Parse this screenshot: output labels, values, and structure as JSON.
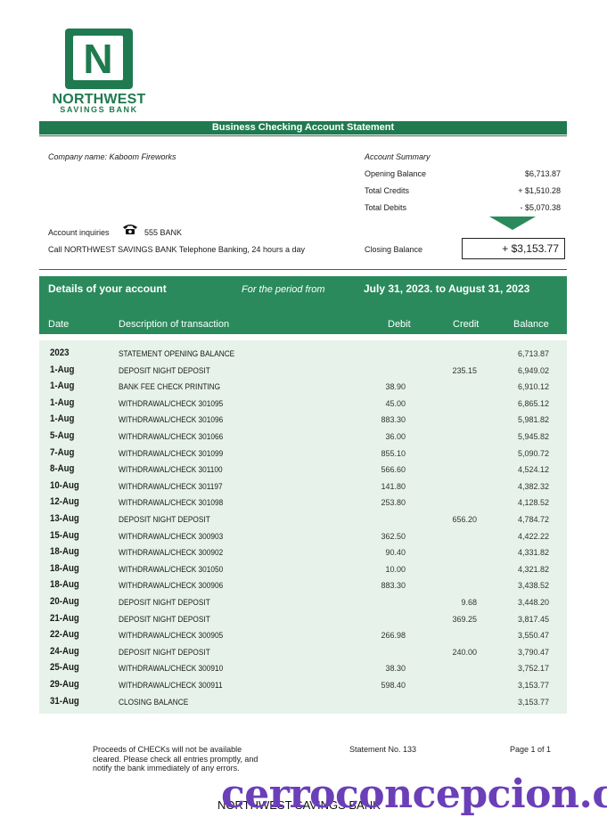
{
  "bank": {
    "logo_letter": "N",
    "name": "NORTHWEST",
    "sub": "SAVINGS BANK",
    "brand_color": "#1f7a4f"
  },
  "title": "Business Checking Account Statement",
  "company": "Company name: Kaboom Fireworks",
  "summary": {
    "heading": "Account Summary",
    "opening_label": "Opening Balance",
    "opening_value": "$6,713.87",
    "credits_label": "Total Credits",
    "credits_value": "+ $1,510.28",
    "debits_label": "Total Debits",
    "debits_value": "- $5,070.38",
    "closing_label": "Closing Balance",
    "closing_value": "+ $3,153.77"
  },
  "inquiries": {
    "label": "Account inquiries",
    "phone_icon": "telephone-icon",
    "phone": "555 BANK",
    "note": "Call NORTHWEST SAVINGS BANK Telephone Banking, 24 hours a day"
  },
  "details": {
    "heading": "Details of your account",
    "period_label": "For the period from",
    "period": "July 31, 2023. to August 31, 2023"
  },
  "columns": {
    "date": "Date",
    "desc": "Description of transaction",
    "debit": "Debit",
    "credit": "Credit",
    "balance": "Balance"
  },
  "transactions": [
    {
      "date": "2023",
      "desc": "STATEMENT OPENING BALANCE",
      "debit": "",
      "credit": "",
      "balance": "6,713.87"
    },
    {
      "date": "1-Aug",
      "desc": "DEPOSIT NIGHT DEPOSIT",
      "debit": "",
      "credit": "235.15",
      "balance": "6,949.02"
    },
    {
      "date": "1-Aug",
      "desc": "BANK FEE CHECK PRINTING",
      "debit": "38.90",
      "credit": "",
      "balance": "6,910.12"
    },
    {
      "date": "1-Aug",
      "desc": "WITHDRAWAL/CHECK 301095",
      "debit": "45.00",
      "credit": "",
      "balance": "6,865.12"
    },
    {
      "date": "1-Aug",
      "desc": "WITHDRAWAL/CHECK 301096",
      "debit": "883.30",
      "credit": "",
      "balance": "5,981.82"
    },
    {
      "date": "5-Aug",
      "desc": "WITHDRAWAL/CHECK 301066",
      "debit": "36.00",
      "credit": "",
      "balance": "5,945.82"
    },
    {
      "date": "7-Aug",
      "desc": "WITHDRAWAL/CHECK 301099",
      "debit": "855.10",
      "credit": "",
      "balance": "5,090.72"
    },
    {
      "date": "8-Aug",
      "desc": "WITHDRAWAL/CHECK 301100",
      "debit": "566.60",
      "credit": "",
      "balance": "4,524.12"
    },
    {
      "date": "10-Aug",
      "desc": "WITHDRAWAL/CHECK 301197",
      "debit": "141.80",
      "credit": "",
      "balance": "4,382.32"
    },
    {
      "date": "12-Aug",
      "desc": "WITHDRAWAL/CHECK 301098",
      "debit": "253.80",
      "credit": "",
      "balance": "4,128.52"
    },
    {
      "date": "13-Aug",
      "desc": "DEPOSIT NIGHT DEPOSIT",
      "debit": "",
      "credit": "656.20",
      "balance": "4,784.72"
    },
    {
      "date": "15-Aug",
      "desc": "WITHDRAWAL/CHECK 300903",
      "debit": "362.50",
      "credit": "",
      "balance": "4,422.22"
    },
    {
      "date": "18-Aug",
      "desc": "WITHDRAWAL/CHECK 300902",
      "debit": "90.40",
      "credit": "",
      "balance": "4,331.82"
    },
    {
      "date": "18-Aug",
      "desc": "WITHDRAWAL/CHECK 301050",
      "debit": "10.00",
      "credit": "",
      "balance": "4,321.82"
    },
    {
      "date": "18-Aug",
      "desc": "WITHDRAWAL/CHECK 300906",
      "debit": "883.30",
      "credit": "",
      "balance": "3,438.52"
    },
    {
      "date": "20-Aug",
      "desc": "DEPOSIT NIGHT DEPOSIT",
      "debit": "",
      "credit": "9.68",
      "balance": "3,448.20"
    },
    {
      "date": "21-Aug",
      "desc": "DEPOSIT NIGHT DEPOSIT",
      "debit": "",
      "credit": "369.25",
      "balance": "3,817.45"
    },
    {
      "date": "22-Aug",
      "desc": "WITHDRAWAL/CHECK 300905",
      "debit": "266.98",
      "credit": "",
      "balance": "3,550.47"
    },
    {
      "date": "24-Aug",
      "desc": "DEPOSIT NIGHT DEPOSIT",
      "debit": "",
      "credit": "240.00",
      "balance": "3,790.47"
    },
    {
      "date": "25-Aug",
      "desc": "WITHDRAWAL/CHECK 300910",
      "debit": "38.30",
      "credit": "",
      "balance": "3,752.17"
    },
    {
      "date": "29-Aug",
      "desc": "WITHDRAWAL/CHECK 300911",
      "debit": "598.40",
      "credit": "",
      "balance": "3,153.77"
    },
    {
      "date": "31-Aug",
      "desc": "CLOSING BALANCE",
      "debit": "",
      "credit": "",
      "balance": "3,153.77"
    }
  ],
  "footer": {
    "note_line1": "Proceeds of CHECKs will not be available",
    "note_line2": "cleared. Please check all entries promptly, and",
    "note_line3": "notify the bank immediately of any errors.",
    "statement_no": "Statement No.  133",
    "page": "Page 1 of 1",
    "bank_name": "NORTHWEST SAVINGS BANK",
    "watermark": "cerroconcepcion.cl"
  }
}
